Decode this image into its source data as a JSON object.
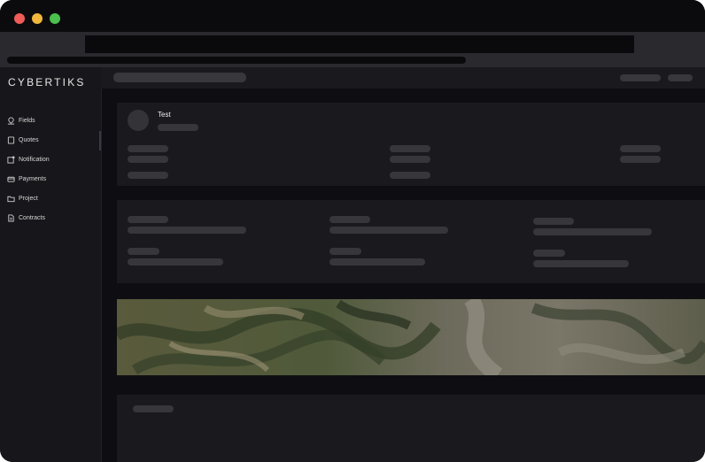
{
  "window": {
    "controls": [
      "close-icon",
      "minimize-icon",
      "maximize-icon"
    ]
  },
  "sidebar": {
    "logo": "CYBERTIKS",
    "items": [
      {
        "label": "Fields",
        "icon": "fields-icon"
      },
      {
        "label": "Quotes",
        "icon": "quotes-icon"
      },
      {
        "label": "Notification",
        "icon": "notification-icon"
      },
      {
        "label": "Payments",
        "icon": "payments-icon"
      },
      {
        "label": "Project",
        "icon": "folder-icon"
      },
      {
        "label": "Contracts",
        "icon": "contracts-icon"
      }
    ]
  },
  "profile": {
    "name": "Test"
  },
  "map": {
    "type": "satellite-imagery"
  }
}
